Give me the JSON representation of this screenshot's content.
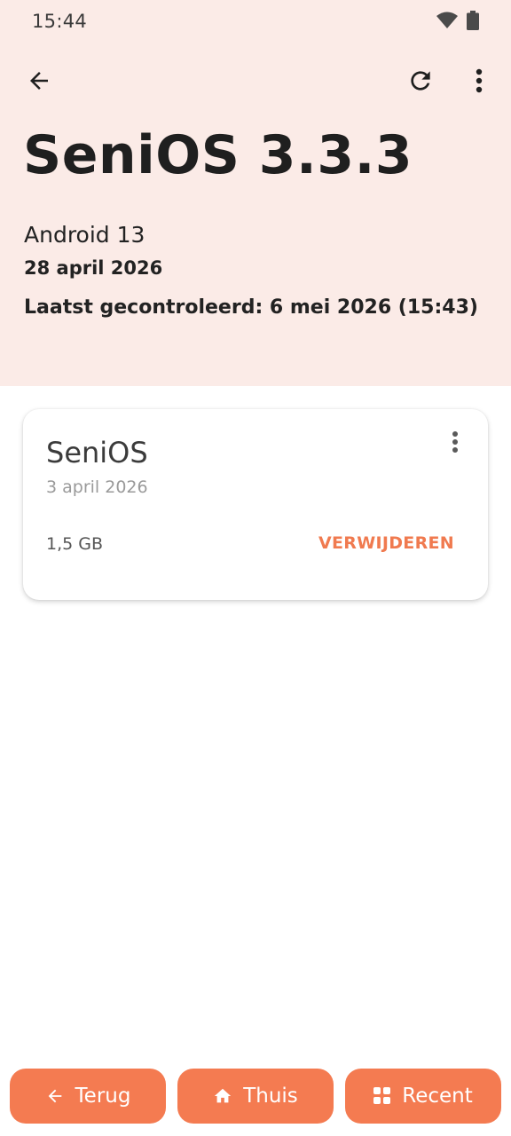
{
  "status_bar": {
    "time": "15:44",
    "icons": [
      "wifi-icon",
      "battery-icon"
    ]
  },
  "toolbar": {
    "back_icon": "arrow-left-icon",
    "refresh_icon": "refresh-icon",
    "more_icon": "more-vert-icon"
  },
  "header": {
    "title": "SeniOS 3.3.3",
    "os_version": "Android 13",
    "release_date": "28 april 2026",
    "last_checked": "Laatst gecontroleerd: 6 mei 2026 (15:43)"
  },
  "update_card": {
    "title": "SeniOS",
    "date": "3 april 2026",
    "size": "1,5 GB",
    "action_label": "VERWIJDEREN"
  },
  "bottom_nav": {
    "back_label": "Terug",
    "home_label": "Thuis",
    "recent_label": "Recent"
  },
  "colors": {
    "header_bg": "#fbebe7",
    "accent": "#f47b51",
    "action_text": "#f07a4f"
  }
}
